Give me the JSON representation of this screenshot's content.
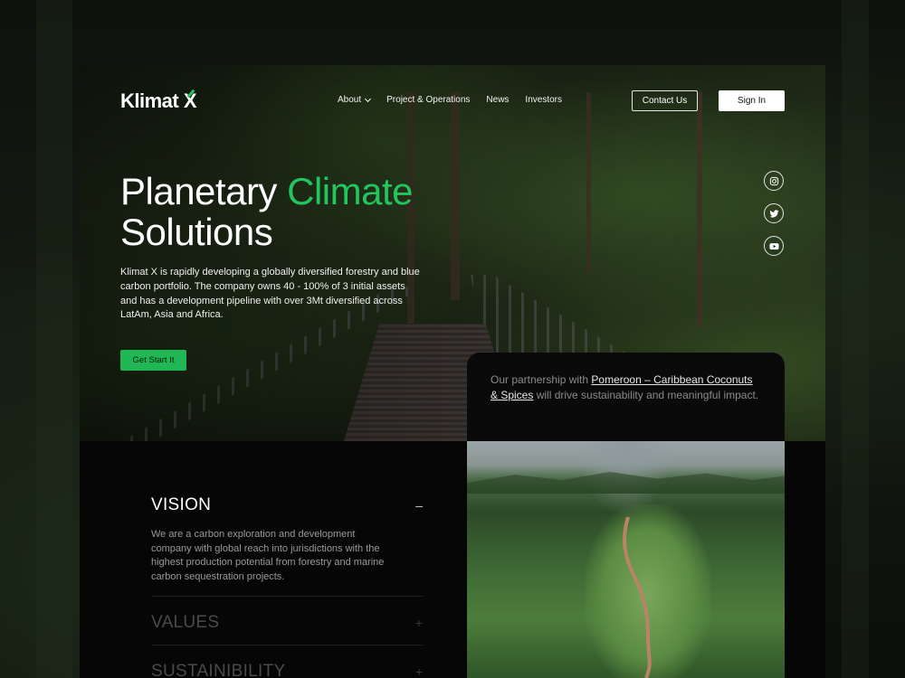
{
  "brand": {
    "name_main": "Klimat",
    "name_x": "X"
  },
  "nav": {
    "items": [
      {
        "label": "About",
        "has_dropdown": true
      },
      {
        "label": "Project & Operations",
        "has_dropdown": false
      },
      {
        "label": "News",
        "has_dropdown": false
      },
      {
        "label": "Investors",
        "has_dropdown": false
      }
    ],
    "contact_label": "Contact Us",
    "signin_label": "Sign In"
  },
  "hero": {
    "title_part1": "Planetary ",
    "title_accent": "Climate",
    "title_part2": "Solutions",
    "description": "Klimat X is rapidly developing a globally diversified forestry and blue carbon portfolio. The company owns 40 - 100% of 3 initial assets and has a development pipeline with over 3Mt diversified across LatAm, Asia and Africa.",
    "cta_label": "Get Start It"
  },
  "socials": [
    {
      "icon": "instagram-icon"
    },
    {
      "icon": "twitter-icon"
    },
    {
      "icon": "youtube-icon"
    }
  ],
  "partnership": {
    "prefix": "Our partnership with ",
    "link_text": "Pomeroon – Caribbean Coconuts & Spices",
    "suffix": " will drive sustainability and meaningful impact."
  },
  "accordion": [
    {
      "title": "VISION",
      "toggle": "–",
      "expanded": true,
      "body": "We are a carbon exploration and development company with global reach into jurisdictions with the highest production potential from forestry and marine carbon sequestration projects."
    },
    {
      "title": "VALUES",
      "toggle": "+",
      "expanded": false
    },
    {
      "title": "SUSTAINIBILITY",
      "toggle": "+",
      "expanded": false
    }
  ],
  "colors": {
    "accent": "#22c55e",
    "cta_bg": "#1fb854",
    "frame_bg": "#060606"
  }
}
